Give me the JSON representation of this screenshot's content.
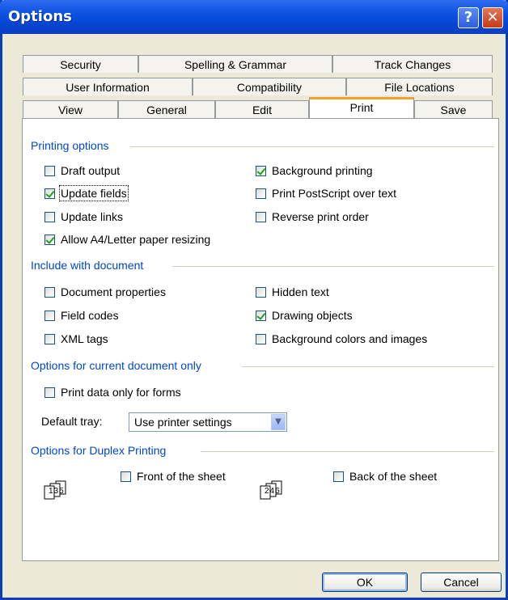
{
  "window": {
    "title": "Options"
  },
  "tabs": {
    "row1": [
      "Security",
      "Spelling & Grammar",
      "Track Changes"
    ],
    "row2": [
      "User Information",
      "Compatibility",
      "File Locations"
    ],
    "row3": [
      "View",
      "General",
      "Edit",
      "Print",
      "Save"
    ],
    "active": "Print"
  },
  "printing_options": {
    "heading": "Printing options",
    "draft_output": "Draft output",
    "update_fields": "Update fields",
    "update_links": "Update links",
    "allow_resize": "Allow A4/Letter paper resizing",
    "background_printing": "Background printing",
    "postscript_over_text": "Print PostScript over text",
    "reverse_order": "Reverse print order"
  },
  "include_with_document": {
    "heading": "Include with document",
    "document_properties": "Document properties",
    "field_codes": "Field codes",
    "xml_tags": "XML tags",
    "hidden_text": "Hidden text",
    "drawing_objects": "Drawing objects",
    "background_colors": "Background colors and images"
  },
  "current_document": {
    "heading": "Options for current document only",
    "print_data_only": "Print data only for forms",
    "default_tray_label": "Default tray:",
    "default_tray_value": "Use printer settings"
  },
  "duplex": {
    "heading": "Options for Duplex Printing",
    "front": "Front of the sheet",
    "back": "Back of the sheet",
    "front_pages": "135",
    "back_pages": "246"
  },
  "buttons": {
    "ok": "OK",
    "cancel": "Cancel"
  },
  "checked": {
    "draft_output": false,
    "update_fields": true,
    "update_links": false,
    "allow_resize": true,
    "background_printing": true,
    "postscript_over_text": false,
    "reverse_order": false,
    "document_properties": false,
    "field_codes": false,
    "xml_tags": false,
    "hidden_text": false,
    "drawing_objects": true,
    "background_colors": false,
    "print_data_only": false,
    "front": false,
    "back": false
  }
}
